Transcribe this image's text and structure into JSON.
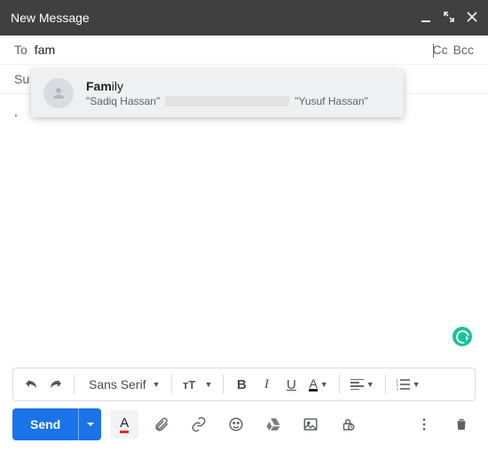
{
  "header": {
    "title": "New Message"
  },
  "recipients": {
    "to_label": "To",
    "to_value": "fam",
    "cc": "Cc",
    "bcc": "Bcc"
  },
  "subject": {
    "placeholder": "Subject",
    "partial": "Su"
  },
  "body": {
    "text": "."
  },
  "suggestion": {
    "name_bold": "Fam",
    "name_rest": "ily",
    "member1": "\"Sadiq Hassan\"",
    "member2": "\"Yusuf Hassan\""
  },
  "toolbar": {
    "font": "Sans Serif"
  },
  "send": {
    "label": "Send"
  }
}
